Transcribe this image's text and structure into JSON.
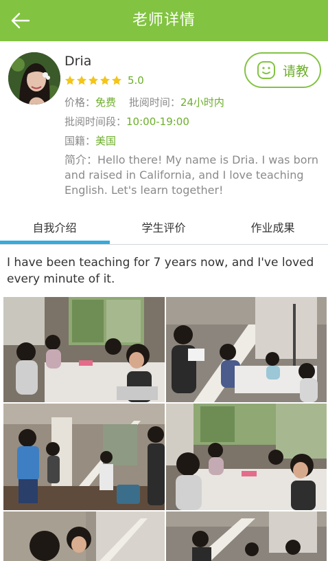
{
  "header": {
    "title": "老师详情",
    "back_icon": "arrow-left-icon"
  },
  "teacher": {
    "name": "Dria",
    "stars": 5,
    "rating": "5.0",
    "price_label": "价格：",
    "price": "免费",
    "review_time_label": "批阅时间：",
    "review_time": "24小时内",
    "review_period_label": "批阅时间段：",
    "review_period": "10:00-19:00",
    "nationality_label": "国籍：",
    "nationality": "美国",
    "intro": "简介：Hello there! My name is Dria. I was born and raised in California, and I love teaching English. Let's learn together!"
  },
  "ask_button": {
    "label": "请教",
    "icon": "smiley-icon"
  },
  "tabs": [
    {
      "label": "自我介绍",
      "active": true
    },
    {
      "label": "学生评价",
      "active": false
    },
    {
      "label": "作业成果",
      "active": false
    }
  ],
  "bio": "I have been teaching for 7 years now, and I've loved every minute of it.",
  "colors": {
    "brand_green": "#82c341",
    "value_green": "#6cae2a",
    "tab_accent": "#36aadb",
    "star": "#f3c51b"
  }
}
